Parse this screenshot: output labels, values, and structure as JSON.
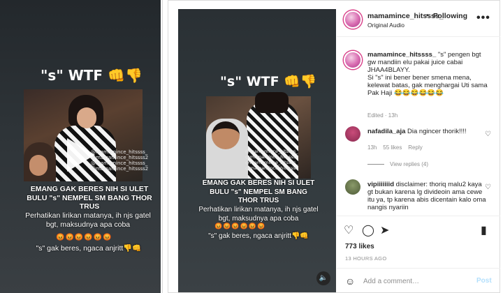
{
  "video": {
    "top_caption": "\"s\" WTF 👊👎",
    "watermarks": [
      "@mamamince_hitssss_",
      "@mamamince_hitssss2",
      "@mamamince_hitssss_",
      "@mamamince_hitssss2"
    ],
    "caption_main": "EMANG GAK BERES NIH SI ULET BULU \"s\" NEMPEL SM BANG THOR TRUS",
    "caption_sub": "Perhatikan lirikan matanya, ih njs gatel bgt, maksudnya apa coba",
    "emoji_row": "😡😡😡😡😡😡",
    "caption_end": "\"s\" gak beres, ngaca anjritt👎👊"
  },
  "post": {
    "username": "mamamince_hitssss_",
    "separator": "•",
    "follow_label": "Following",
    "audio_label": "Original Audio",
    "more_icon": "•••",
    "caption_user": "mamamince_hitssss_",
    "caption_text": " \"s\" pengen bgt gw mandiin elu pakai juice cabai JHAA4BLAYY.\nSi \"s\" ini bener bener smena mena, kelewat batas, gak menghargai Uti sama Pak Haji 😂😂😂😂😂😂",
    "caption_meta": "Edited · 13h"
  },
  "comments": [
    {
      "user": "nafadila_aja",
      "text": " Dia ngincer thorik!!!!",
      "time": "13h",
      "likes": "55 likes",
      "reply": "Reply",
      "view_replies": "View replies (4)"
    },
    {
      "user": "vipiiiiiiid",
      "text": " disclaimer: thoriq malu2 kaya gt bukan karena lg divideoin ama cewe itu ya, tp karena abis dicentain kalo oma nangis nyariin"
    }
  ],
  "actions": {
    "likes": "773 likes",
    "time_ago": "13 HOURS AGO",
    "comment_placeholder": "Add a comment…",
    "post_label": "Post"
  },
  "colors": {
    "text": "#262626",
    "muted": "#8e8e8e",
    "post_button_disabled": "#b2dffc",
    "border": "#dbdbdb"
  }
}
